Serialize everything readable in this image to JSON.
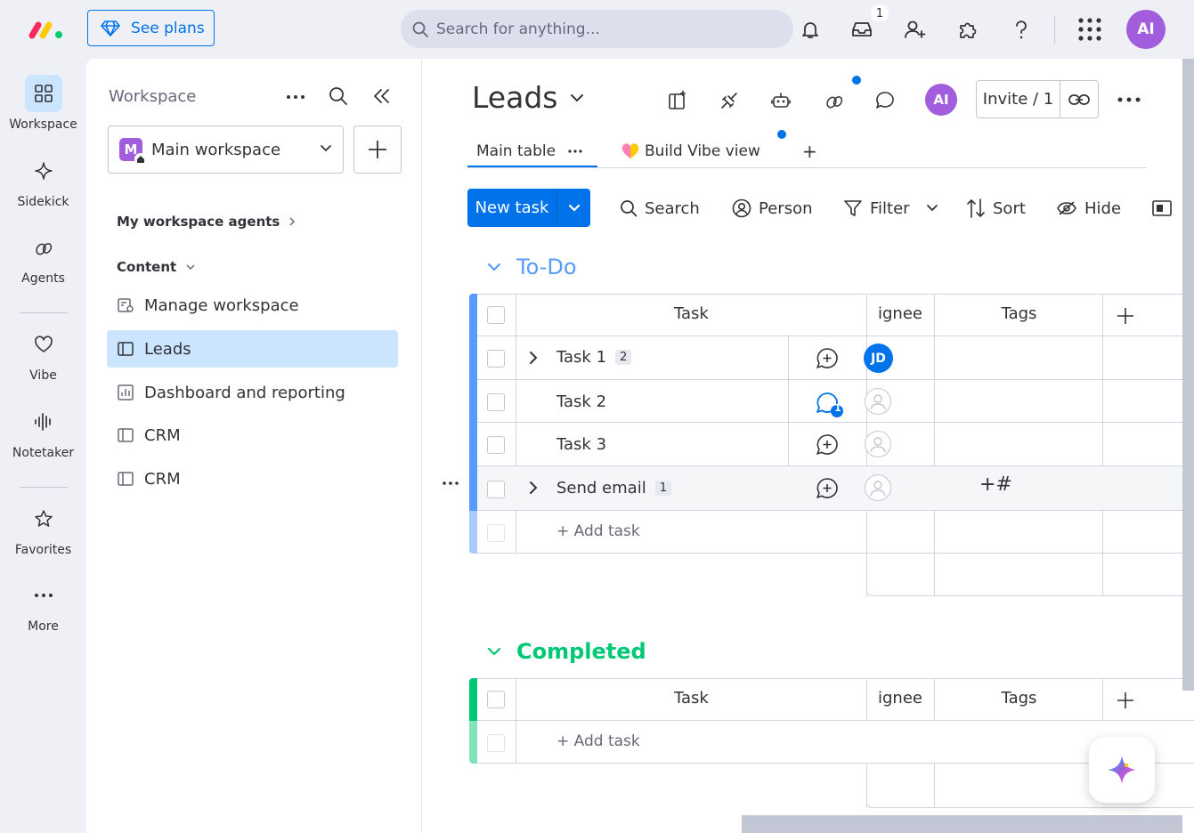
{
  "topbar": {
    "see_plans": "See plans",
    "search_placeholder": "Search for anything...",
    "inbox_count": "1",
    "avatar_initials": "AI",
    "icons": [
      "bell-icon",
      "inbox-icon",
      "invite-user-icon",
      "puzzle-icon",
      "help-icon",
      "apps-grid-icon"
    ]
  },
  "rail": {
    "items": [
      {
        "label": "Workspace",
        "icon": "workspace-grid-icon"
      },
      {
        "label": "Sidekick",
        "icon": "sparkle-icon"
      },
      {
        "label": "Agents",
        "icon": "agents-icon"
      },
      {
        "label": "Vibe",
        "icon": "heart-icon"
      },
      {
        "label": "Notetaker",
        "icon": "soundwave-icon"
      },
      {
        "label": "Favorites",
        "icon": "star-icon"
      },
      {
        "label": "More",
        "icon": "more-dots-icon"
      }
    ]
  },
  "workspace": {
    "title": "Workspace",
    "selected": "Main workspace",
    "badge_letter": "M",
    "agents_section": "My workspace agents",
    "content_section": "Content",
    "items": [
      {
        "label": "Manage workspace",
        "icon": "manage-workspace-icon"
      },
      {
        "label": "Leads",
        "icon": "board-icon"
      },
      {
        "label": "Dashboard and reporting",
        "icon": "dashboard-icon"
      },
      {
        "label": "CRM",
        "icon": "board-icon"
      },
      {
        "label": "CRM",
        "icon": "board-icon"
      }
    ]
  },
  "board": {
    "title": "Leads",
    "avatar_initials": "AI",
    "invite": "Invite / 1",
    "tabs": [
      {
        "label": "Main table"
      },
      {
        "label": "Build Vibe view"
      },
      {
        "label": "+"
      }
    ],
    "toolbar": {
      "new_task": "New task",
      "search": "Search",
      "person": "Person",
      "filter": "Filter",
      "sort": "Sort",
      "hide": "Hide"
    },
    "groups": [
      {
        "title": "To-Do",
        "color": "#579bfc",
        "columns": {
          "task": "Task",
          "assignee": "Assignee",
          "assignee_visible": "ignee",
          "tags": "Tags"
        },
        "rows": [
          {
            "name": "Task 1",
            "subitems": "2",
            "assignee": "JD",
            "expandable": true
          },
          {
            "name": "Task 2",
            "updates": "1",
            "expandable": false
          },
          {
            "name": "Task 3",
            "expandable": false
          },
          {
            "name": "Send email",
            "subitems": "1",
            "expandable": true,
            "tags_add": "+#"
          }
        ],
        "add_task": "+ Add task"
      },
      {
        "title": "Completed",
        "color": "#00c875",
        "columns": {
          "task": "Task",
          "assignee": "Assignee",
          "assignee_visible": "ignee",
          "tags": "Tags"
        },
        "rows": [],
        "add_task": "+ Add task"
      }
    ]
  },
  "colors": {
    "primary": "#0073ea",
    "selected_bg": "#cce5ff",
    "avatar_purple": "#a25ddc",
    "todo_blue": "#579bfc",
    "done_green": "#00c875"
  }
}
